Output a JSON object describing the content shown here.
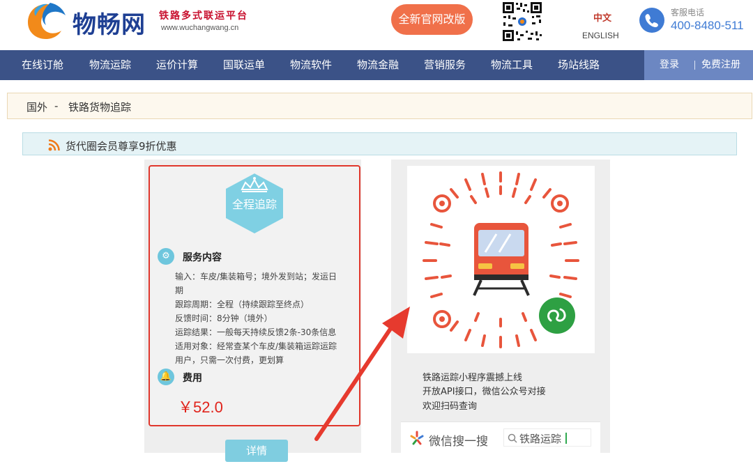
{
  "header": {
    "brand_name": "物畅网",
    "tagline": "铁路多式联运平台",
    "website": "www.wuchangwang.cn",
    "new_site_button": "全新官网改版",
    "lang_zh": "中文",
    "lang_en": "ENGLISH",
    "hotline_label": "客服电话",
    "hotline_number": "400-8480-511"
  },
  "nav": {
    "items": [
      "在线订舱",
      "物流运踪",
      "运价计算",
      "国联运单",
      "物流软件",
      "物流金融",
      "营销服务",
      "物流工具",
      "场站线路"
    ],
    "login": "登录",
    "register": "免费注册"
  },
  "breadcrumb": {
    "items": [
      "国外",
      "-",
      "铁路货物追踪"
    ]
  },
  "promo": {
    "text": "货代圈会员尊享9折优惠"
  },
  "card": {
    "badge": "全程追踪",
    "service_title": "服务内容",
    "details": [
      "输入：车皮/集装箱号；境外发到站；发运日",
      "期",
      "跟踪周期：全程（持续跟踪至终点）",
      "反馈时间：8分钟（境外）",
      "运踪结果：一般每天持续反馈2条-30条信息",
      "适用对象：经常查某个车皮/集装箱运踪运踪",
      "用户，只需一次付费，更划算"
    ],
    "fee_title": "费用",
    "price": "￥52.0",
    "detail_button": "详情"
  },
  "miniprogram": {
    "lines": [
      "铁路运踪小程序震撼上线",
      "开放API接口，微信公众号对接",
      "欢迎扫码查询"
    ],
    "wechat_search_label": "微信搜一搜",
    "search_query": "铁路运踪"
  },
  "colors": {
    "nav_bg": "#3b5287",
    "accent_orange": "#f0704a",
    "brand_blue": "#1e3f93",
    "price_red": "#e0231b",
    "card_border": "#e0372c",
    "teal": "#7fcde0"
  }
}
